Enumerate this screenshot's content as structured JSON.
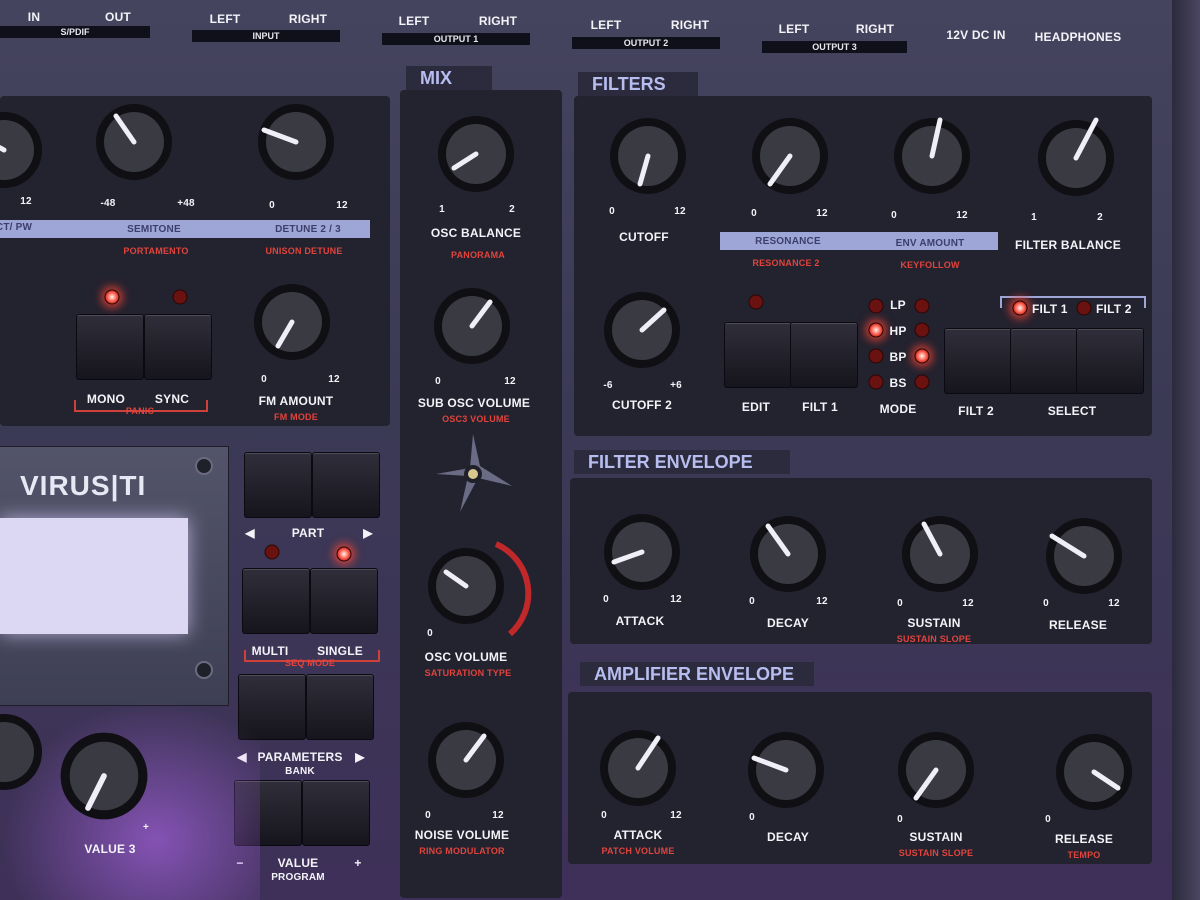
{
  "top_jacks": {
    "spdif": {
      "in": "IN",
      "out": "OUT",
      "bar": "S/PDIF"
    },
    "input": {
      "left": "LEFT",
      "right": "RIGHT",
      "bar": "INPUT"
    },
    "output1": {
      "left": "LEFT",
      "right": "RIGHT",
      "bar": "OUTPUT 1"
    },
    "output2": {
      "left": "LEFT",
      "right": "RIGHT",
      "bar": "OUTPUT 2"
    },
    "output3": {
      "left": "LEFT",
      "right": "RIGHT",
      "bar": "OUTPUT 3"
    },
    "dc_in": "12V DC IN",
    "headphones": "HEADPHONES"
  },
  "oscillator": {
    "strip_left": "CT/ PW",
    "strip_semitone": "SEMITONE",
    "strip_detune": "DETUNE 2 / 3",
    "portamento": "PORTAMENTO",
    "unison_detune": "UNISON DETUNE",
    "k0_max": "12",
    "semitone_min": "-48",
    "semitone_max": "+48",
    "detune_min": "0",
    "detune_max": "12",
    "mono_label": "MONO",
    "sync_label": "SYNC",
    "panic": "PANIC",
    "fm_amount": "FM AMOUNT",
    "fm_mode": "FM MODE",
    "fm_min": "0",
    "fm_max": "12"
  },
  "mix": {
    "title": "MIX",
    "osc_balance": "OSC  BALANCE",
    "panorama": "PANORAMA",
    "bal_min": "1",
    "bal_max": "2",
    "sub_osc_volume": "SUB OSC VOLUME",
    "osc3_volume": "OSC3 VOLUME",
    "sub_min": "0",
    "sub_max": "12",
    "osc_volume": "OSC VOLUME",
    "saturation_type": "SATURATION TYPE",
    "osc_vol_min": "0",
    "noise_volume": "NOISE VOLUME",
    "ring_modulator": "RING MODULATOR",
    "noise_min": "0",
    "noise_max": "12"
  },
  "filters": {
    "title": "FILTERS",
    "cutoff": "CUTOFF",
    "cutoff_min": "0",
    "cutoff_max": "12",
    "resonance": "RESONANCE",
    "resonance2": "RESONANCE 2",
    "res_min": "0",
    "res_max": "12",
    "env_amount": "ENV AMOUNT",
    "keyfollow": "KEYFOLLOW",
    "env_min": "0",
    "env_max": "12",
    "filter_balance": "FILTER BALANCE",
    "fb_min": "1",
    "fb_max": "2",
    "cutoff2": "CUTOFF 2",
    "c2_min": "-6",
    "c2_max": "+6",
    "edit": "EDIT",
    "filt1_btn": "FILT 1",
    "mode": "MODE",
    "lp": "LP",
    "hp": "HP",
    "bp": "BP",
    "bs": "BS",
    "filt2_btn": "FILT 2",
    "select": "SELECT",
    "filt1_led": "FILT 1",
    "filt2_led": "FILT 2"
  },
  "filter_envelope": {
    "title": "FILTER ENVELOPE",
    "attack": "ATTACK",
    "decay": "DECAY",
    "sustain": "SUSTAIN",
    "sustain_slope": "SUSTAIN SLOPE",
    "release": "RELEASE",
    "min": "0",
    "max": "12"
  },
  "amplifier_envelope": {
    "title": "AMPLIFIER ENVELOPE",
    "attack": "ATTACK",
    "patch_volume": "PATCH VOLUME",
    "decay": "DECAY",
    "sustain": "SUSTAIN",
    "sustain_slope": "SUSTAIN SLOPE",
    "release": "RELEASE",
    "tempo": "TEMPO",
    "min": "0",
    "max": "12"
  },
  "display": {
    "logo": "VIRUS|TI"
  },
  "part_section": {
    "part": "PART",
    "multi": "MULTI",
    "single": "SINGLE",
    "seq_mode": "SEQ MODE",
    "parameters": "PARAMETERS",
    "bank": "BANK",
    "value": "VALUE",
    "program": "PROGRAM",
    "minus": "−",
    "plus": "+",
    "left_arrow": "◀",
    "right_arrow": "▶"
  },
  "value3": {
    "label": "VALUE 3",
    "plus": "+"
  },
  "colors": {
    "panel": "#3b3a55",
    "section": "#23222f",
    "accent_header": "#b8bdf0",
    "strip": "#9ea6d8",
    "secondary_label": "#e0443c",
    "led_on": "#ff5a44"
  }
}
